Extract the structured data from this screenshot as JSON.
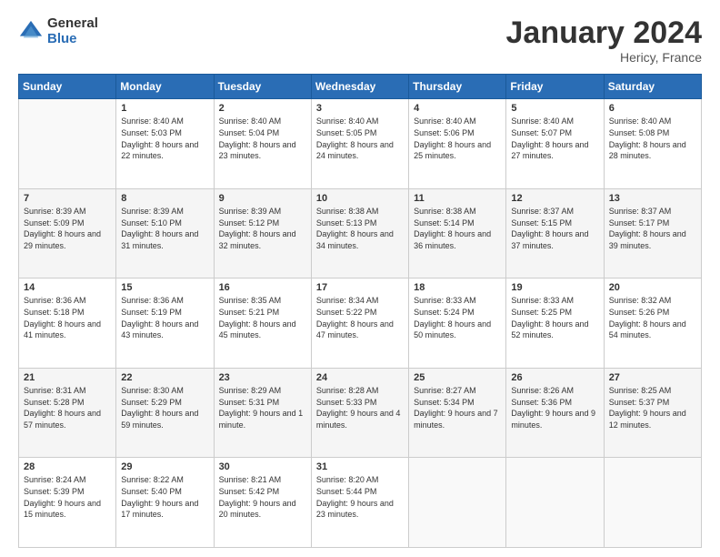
{
  "logo": {
    "general": "General",
    "blue": "Blue"
  },
  "header": {
    "month": "January 2024",
    "location": "Hericy, France"
  },
  "days": [
    "Sunday",
    "Monday",
    "Tuesday",
    "Wednesday",
    "Thursday",
    "Friday",
    "Saturday"
  ],
  "weeks": [
    [
      {
        "day": "",
        "sunrise": "",
        "sunset": "",
        "daylight": ""
      },
      {
        "day": "1",
        "sunrise": "Sunrise: 8:40 AM",
        "sunset": "Sunset: 5:03 PM",
        "daylight": "Daylight: 8 hours and 22 minutes."
      },
      {
        "day": "2",
        "sunrise": "Sunrise: 8:40 AM",
        "sunset": "Sunset: 5:04 PM",
        "daylight": "Daylight: 8 hours and 23 minutes."
      },
      {
        "day": "3",
        "sunrise": "Sunrise: 8:40 AM",
        "sunset": "Sunset: 5:05 PM",
        "daylight": "Daylight: 8 hours and 24 minutes."
      },
      {
        "day": "4",
        "sunrise": "Sunrise: 8:40 AM",
        "sunset": "Sunset: 5:06 PM",
        "daylight": "Daylight: 8 hours and 25 minutes."
      },
      {
        "day": "5",
        "sunrise": "Sunrise: 8:40 AM",
        "sunset": "Sunset: 5:07 PM",
        "daylight": "Daylight: 8 hours and 27 minutes."
      },
      {
        "day": "6",
        "sunrise": "Sunrise: 8:40 AM",
        "sunset": "Sunset: 5:08 PM",
        "daylight": "Daylight: 8 hours and 28 minutes."
      }
    ],
    [
      {
        "day": "7",
        "sunrise": "Sunrise: 8:39 AM",
        "sunset": "Sunset: 5:09 PM",
        "daylight": "Daylight: 8 hours and 29 minutes."
      },
      {
        "day": "8",
        "sunrise": "Sunrise: 8:39 AM",
        "sunset": "Sunset: 5:10 PM",
        "daylight": "Daylight: 8 hours and 31 minutes."
      },
      {
        "day": "9",
        "sunrise": "Sunrise: 8:39 AM",
        "sunset": "Sunset: 5:12 PM",
        "daylight": "Daylight: 8 hours and 32 minutes."
      },
      {
        "day": "10",
        "sunrise": "Sunrise: 8:38 AM",
        "sunset": "Sunset: 5:13 PM",
        "daylight": "Daylight: 8 hours and 34 minutes."
      },
      {
        "day": "11",
        "sunrise": "Sunrise: 8:38 AM",
        "sunset": "Sunset: 5:14 PM",
        "daylight": "Daylight: 8 hours and 36 minutes."
      },
      {
        "day": "12",
        "sunrise": "Sunrise: 8:37 AM",
        "sunset": "Sunset: 5:15 PM",
        "daylight": "Daylight: 8 hours and 37 minutes."
      },
      {
        "day": "13",
        "sunrise": "Sunrise: 8:37 AM",
        "sunset": "Sunset: 5:17 PM",
        "daylight": "Daylight: 8 hours and 39 minutes."
      }
    ],
    [
      {
        "day": "14",
        "sunrise": "Sunrise: 8:36 AM",
        "sunset": "Sunset: 5:18 PM",
        "daylight": "Daylight: 8 hours and 41 minutes."
      },
      {
        "day": "15",
        "sunrise": "Sunrise: 8:36 AM",
        "sunset": "Sunset: 5:19 PM",
        "daylight": "Daylight: 8 hours and 43 minutes."
      },
      {
        "day": "16",
        "sunrise": "Sunrise: 8:35 AM",
        "sunset": "Sunset: 5:21 PM",
        "daylight": "Daylight: 8 hours and 45 minutes."
      },
      {
        "day": "17",
        "sunrise": "Sunrise: 8:34 AM",
        "sunset": "Sunset: 5:22 PM",
        "daylight": "Daylight: 8 hours and 47 minutes."
      },
      {
        "day": "18",
        "sunrise": "Sunrise: 8:33 AM",
        "sunset": "Sunset: 5:24 PM",
        "daylight": "Daylight: 8 hours and 50 minutes."
      },
      {
        "day": "19",
        "sunrise": "Sunrise: 8:33 AM",
        "sunset": "Sunset: 5:25 PM",
        "daylight": "Daylight: 8 hours and 52 minutes."
      },
      {
        "day": "20",
        "sunrise": "Sunrise: 8:32 AM",
        "sunset": "Sunset: 5:26 PM",
        "daylight": "Daylight: 8 hours and 54 minutes."
      }
    ],
    [
      {
        "day": "21",
        "sunrise": "Sunrise: 8:31 AM",
        "sunset": "Sunset: 5:28 PM",
        "daylight": "Daylight: 8 hours and 57 minutes."
      },
      {
        "day": "22",
        "sunrise": "Sunrise: 8:30 AM",
        "sunset": "Sunset: 5:29 PM",
        "daylight": "Daylight: 8 hours and 59 minutes."
      },
      {
        "day": "23",
        "sunrise": "Sunrise: 8:29 AM",
        "sunset": "Sunset: 5:31 PM",
        "daylight": "Daylight: 9 hours and 1 minute."
      },
      {
        "day": "24",
        "sunrise": "Sunrise: 8:28 AM",
        "sunset": "Sunset: 5:33 PM",
        "daylight": "Daylight: 9 hours and 4 minutes."
      },
      {
        "day": "25",
        "sunrise": "Sunrise: 8:27 AM",
        "sunset": "Sunset: 5:34 PM",
        "daylight": "Daylight: 9 hours and 7 minutes."
      },
      {
        "day": "26",
        "sunrise": "Sunrise: 8:26 AM",
        "sunset": "Sunset: 5:36 PM",
        "daylight": "Daylight: 9 hours and 9 minutes."
      },
      {
        "day": "27",
        "sunrise": "Sunrise: 8:25 AM",
        "sunset": "Sunset: 5:37 PM",
        "daylight": "Daylight: 9 hours and 12 minutes."
      }
    ],
    [
      {
        "day": "28",
        "sunrise": "Sunrise: 8:24 AM",
        "sunset": "Sunset: 5:39 PM",
        "daylight": "Daylight: 9 hours and 15 minutes."
      },
      {
        "day": "29",
        "sunrise": "Sunrise: 8:22 AM",
        "sunset": "Sunset: 5:40 PM",
        "daylight": "Daylight: 9 hours and 17 minutes."
      },
      {
        "day": "30",
        "sunrise": "Sunrise: 8:21 AM",
        "sunset": "Sunset: 5:42 PM",
        "daylight": "Daylight: 9 hours and 20 minutes."
      },
      {
        "day": "31",
        "sunrise": "Sunrise: 8:20 AM",
        "sunset": "Sunset: 5:44 PM",
        "daylight": "Daylight: 9 hours and 23 minutes."
      },
      {
        "day": "",
        "sunrise": "",
        "sunset": "",
        "daylight": ""
      },
      {
        "day": "",
        "sunrise": "",
        "sunset": "",
        "daylight": ""
      },
      {
        "day": "",
        "sunrise": "",
        "sunset": "",
        "daylight": ""
      }
    ]
  ]
}
